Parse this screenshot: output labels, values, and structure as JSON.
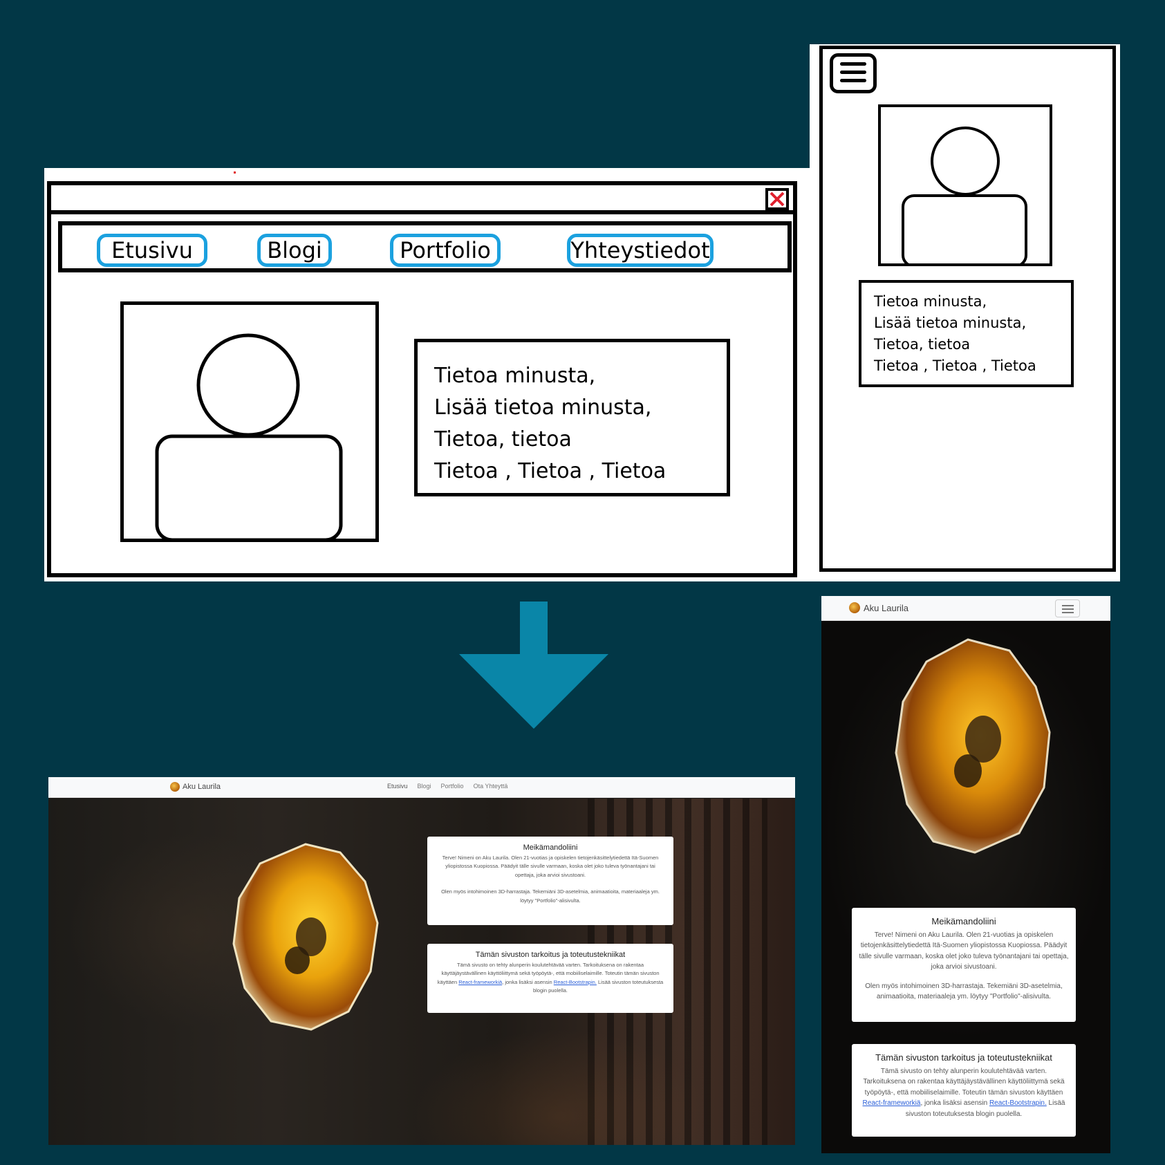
{
  "desktop_wireframe": {
    "nav_items": [
      "Etusivu",
      "Blogi",
      "Portfolio",
      "Yhteystiedot"
    ],
    "text_lines": [
      "Tietoa minusta,",
      "Lisää tietoa minusta,",
      "Tietoa, tietoa",
      "Tietoa , Tietoa , Tietoa"
    ]
  },
  "mobile_wireframe": {
    "text_lines": [
      "Tietoa minusta,",
      "Lisää tietoa minusta,",
      "Tietoa, tietoa",
      "Tietoa , Tietoa , Tietoa"
    ]
  },
  "site": {
    "brand": "Aku Laurila",
    "nav_links": [
      "Etusivu",
      "Blogi",
      "Portfolio",
      "Ota Yhteyttä"
    ],
    "card1": {
      "title": "Meikämandoliini",
      "para1": "Terve! Nimeni on Aku Laurila. Olen 21-vuotias ja opiskelen tietojenkäsittelytiedettä Itä-Suomen yliopistossa Kuopiossa. Päädyit tälle sivulle varmaan, koska olet joko tuleva työnantajani tai opettaja, joka arvioi sivustoani.",
      "para2": "Olen myös intohimoinen 3D-harrastaja. Tekemiäni 3D-asetelmia, animaatioita, materiaaleja ym. löytyy \"Portfolio\"-alisivulta."
    },
    "card2": {
      "title": "Tämän sivuston tarkoitus ja toteutustekniikat",
      "text_a": "Tämä sivusto on tehty alunperin koulutehtävää varten. Tarkoituksena on rakentaa käyttäjäystävällinen käyttöliittymä sekä työpöytä-, että mobiiliselaimille. Toteutin tämän sivuston käyttäen ",
      "link1": "React-frameworkiä",
      "text_b": ", jonka lisäksi asensin ",
      "link2": "React-Bootstrapin.",
      "text_c": " Lisää sivuston toteutuksesta blogin puolella."
    }
  },
  "colors": {
    "background": "#023746",
    "pill_border": "#1ba1df",
    "arrow": "#0a86a8",
    "close_x": "#e0202e",
    "link": "#2b5fd8"
  },
  "icons": [
    "close-icon",
    "hamburger-menu-icon",
    "arrow-down-icon",
    "amber-logo-icon",
    "person-placeholder-icon"
  ]
}
